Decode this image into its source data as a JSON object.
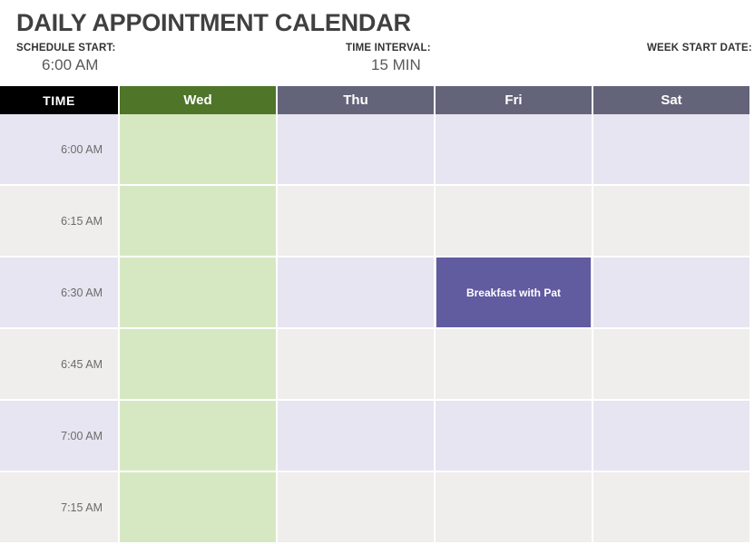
{
  "header": {
    "title": "DAILY APPOINTMENT CALENDAR"
  },
  "settings": [
    {
      "label": "SCHEDULE START:",
      "value": "6:00 AM"
    },
    {
      "label": "TIME INTERVAL:",
      "value": "15 MIN"
    },
    {
      "label": "WEEK START DATE:",
      "value": ""
    }
  ],
  "calendar": {
    "time_column_header": "TIME",
    "day_headers": [
      {
        "label": "Wed",
        "today": true
      },
      {
        "label": "Thu",
        "today": false
      },
      {
        "label": "Fri",
        "today": false
      },
      {
        "label": "Sat",
        "today": false
      }
    ],
    "rows": [
      {
        "time": "6:00 AM",
        "band": "a",
        "cells": [
          {
            "day": "Wed",
            "today": true,
            "appointment": ""
          },
          {
            "day": "Thu",
            "today": false,
            "appointment": ""
          },
          {
            "day": "Fri",
            "today": false,
            "appointment": ""
          },
          {
            "day": "Sat",
            "today": false,
            "appointment": ""
          }
        ]
      },
      {
        "time": "6:15 AM",
        "band": "b",
        "cells": [
          {
            "day": "Wed",
            "today": true,
            "appointment": ""
          },
          {
            "day": "Thu",
            "today": false,
            "appointment": ""
          },
          {
            "day": "Fri",
            "today": false,
            "appointment": ""
          },
          {
            "day": "Sat",
            "today": false,
            "appointment": ""
          }
        ]
      },
      {
        "time": "6:30 AM",
        "band": "a",
        "cells": [
          {
            "day": "Wed",
            "today": true,
            "appointment": ""
          },
          {
            "day": "Thu",
            "today": false,
            "appointment": ""
          },
          {
            "day": "Fri",
            "today": false,
            "appointment": "Breakfast with Pat"
          },
          {
            "day": "Sat",
            "today": false,
            "appointment": ""
          }
        ]
      },
      {
        "time": "6:45 AM",
        "band": "b",
        "cells": [
          {
            "day": "Wed",
            "today": true,
            "appointment": ""
          },
          {
            "day": "Thu",
            "today": false,
            "appointment": ""
          },
          {
            "day": "Fri",
            "today": false,
            "appointment": ""
          },
          {
            "day": "Sat",
            "today": false,
            "appointment": ""
          }
        ]
      },
      {
        "time": "7:00 AM",
        "band": "a",
        "cells": [
          {
            "day": "Wed",
            "today": true,
            "appointment": ""
          },
          {
            "day": "Thu",
            "today": false,
            "appointment": ""
          },
          {
            "day": "Fri",
            "today": false,
            "appointment": ""
          },
          {
            "day": "Sat",
            "today": false,
            "appointment": ""
          }
        ]
      },
      {
        "time": "7:15 AM",
        "band": "b",
        "cells": [
          {
            "day": "Wed",
            "today": true,
            "appointment": ""
          },
          {
            "day": "Thu",
            "today": false,
            "appointment": ""
          },
          {
            "day": "Fri",
            "today": false,
            "appointment": ""
          },
          {
            "day": "Sat",
            "today": false,
            "appointment": ""
          }
        ]
      }
    ]
  },
  "colors": {
    "today_header": "#4f7529",
    "day_header": "#63647a",
    "time_header": "#000000",
    "today_cell": "#d6e8c1",
    "band_a": "#e7e5f1",
    "band_b": "#efeeec",
    "appointment": "#615ba0",
    "title_text": "#404040"
  }
}
